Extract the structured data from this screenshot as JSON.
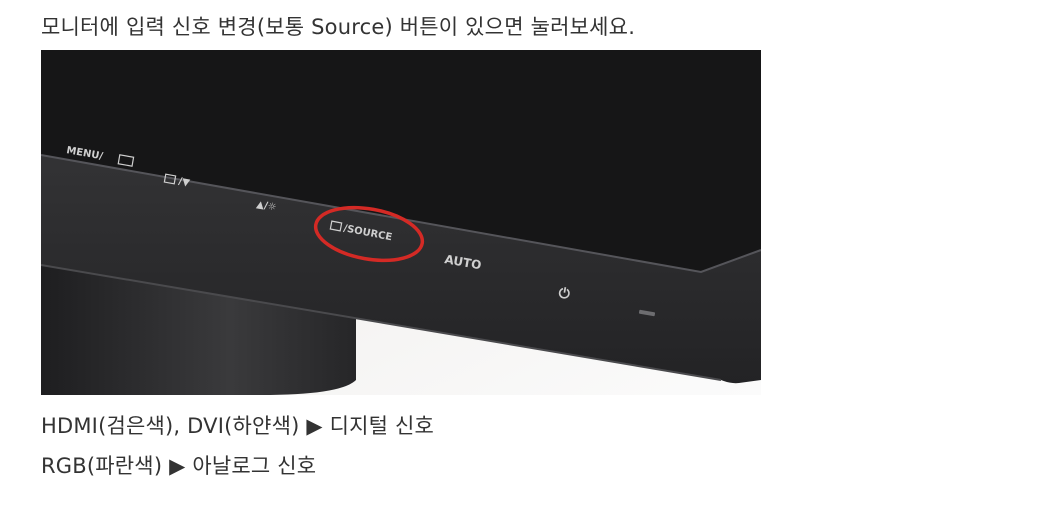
{
  "instruction": "모니터에 입력 신호 변경(보통 Source) 버튼이 있으면 눌러보세요.",
  "photo": {
    "button_labels": {
      "menu": "MENU/",
      "brightness": "▲/☼",
      "source": "/SOURCE",
      "auto": "AUTO",
      "power": "⏻"
    },
    "highlight_color": "#d42a25",
    "bezel_color": "#2b2b2d"
  },
  "signals": [
    "HDMI(검은색), DVI(하얀색) ▶ 디지털 신호",
    "RGB(파란색) ▶ 아날로그 신호"
  ]
}
